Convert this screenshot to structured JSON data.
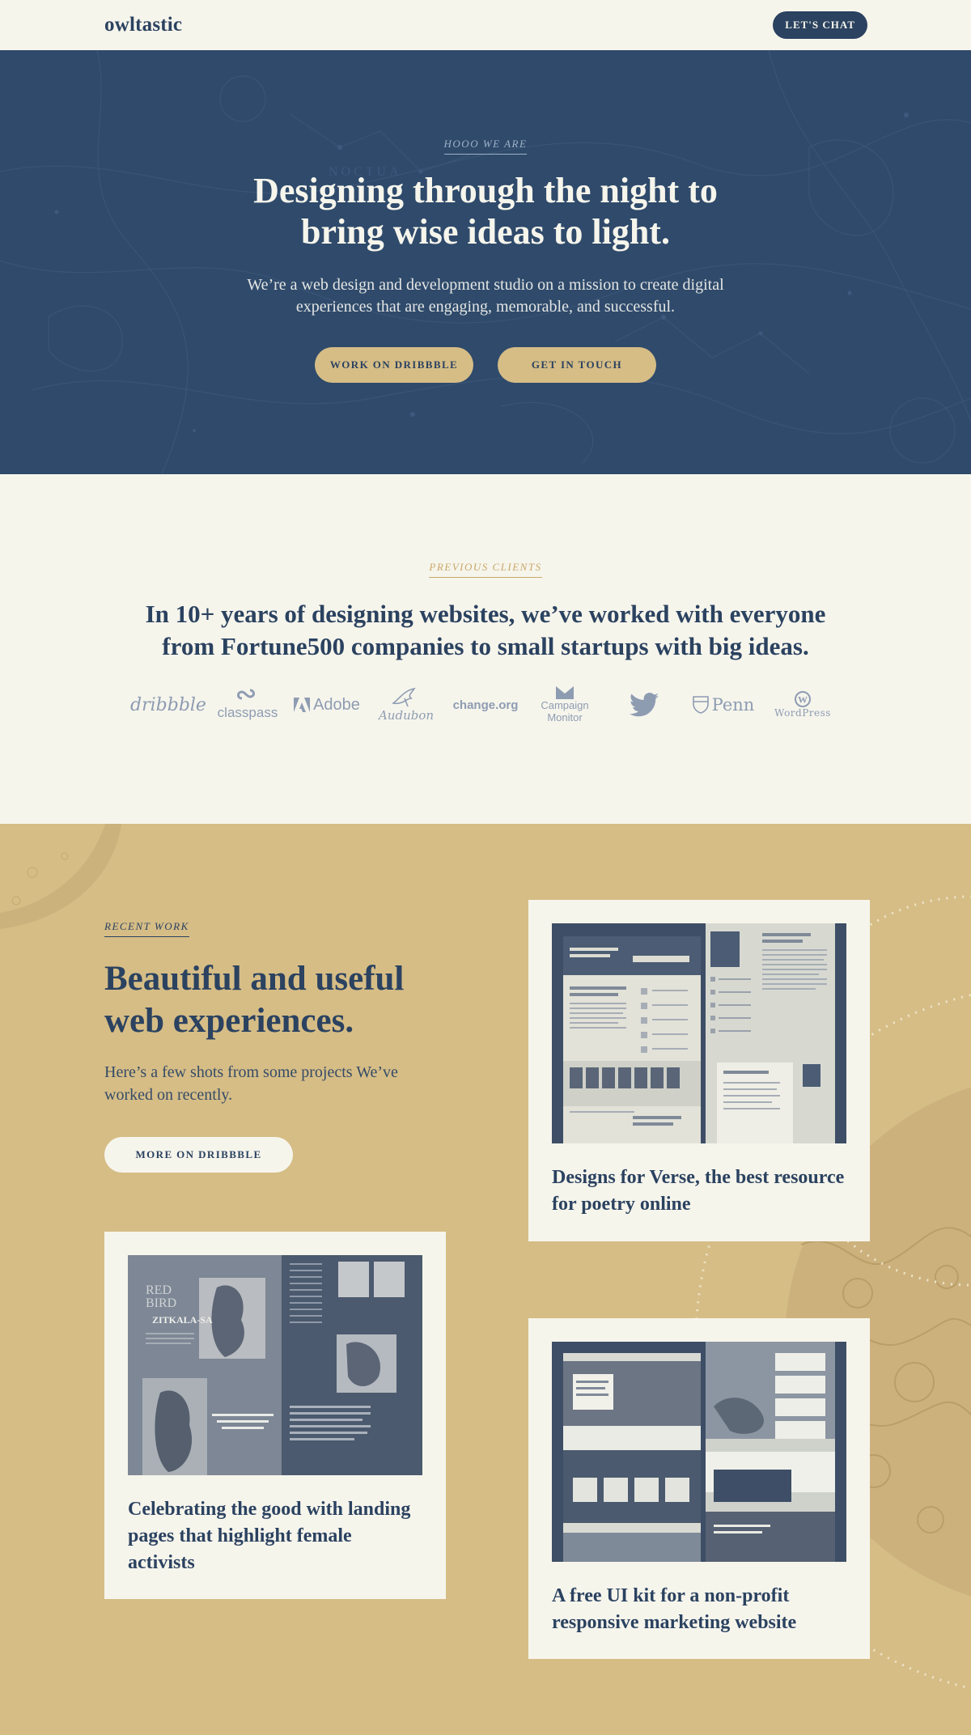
{
  "header": {
    "logo": "owltastic",
    "cta_label": "LET'S CHAT"
  },
  "hero": {
    "eyebrow": "HOOO WE ARE",
    "title_line1": "Designing through the night to",
    "title_line2": "bring wise ideas to light.",
    "description": "We’re a web design and development studio on a mission to create digital experiences that are engaging, memorable, and successful.",
    "buttons": [
      "WORK ON DRIBBBLE",
      "GET IN TOUCH"
    ],
    "map_labels": [
      "NOCTUA"
    ]
  },
  "clients": {
    "eyebrow": "PREVIOUS CLIENTS",
    "title_line1": "In 10+ years of designing websites, we’ve worked with everyone",
    "title_line2": "from Fortune500 companies to small startups with big ideas.",
    "logos": [
      {
        "name": "dribbble",
        "icon": "dribbble-logo"
      },
      {
        "name": "classpass",
        "icon": "classpass-logo"
      },
      {
        "name": "Adobe",
        "icon": "adobe-logo"
      },
      {
        "name": "Audubon",
        "icon": "audubon-logo"
      },
      {
        "name": "change.org",
        "icon": "change-org-logo"
      },
      {
        "name": "Campaign Monitor",
        "icon": "campaign-monitor-logo"
      },
      {
        "name": "",
        "icon": "twitter-logo"
      },
      {
        "name": "Penn",
        "icon": "penn-logo"
      },
      {
        "name": "WordPress",
        "icon": "wordpress-logo"
      }
    ]
  },
  "work": {
    "eyebrow": "RECENT WORK",
    "title_line1": "Beautiful and useful",
    "title_line2": "web experiences.",
    "description": "Here’s a few shots from some projects We’ve worked on recently.",
    "button_label": "MORE ON DRIBBBLE",
    "projects": [
      {
        "title": "Designs for Verse, the best resource for poetry online"
      },
      {
        "title": "Celebrating the good with landing pages that highlight female activists"
      },
      {
        "title": "A free UI kit for a non-profit responsive marketing website"
      }
    ]
  },
  "colors": {
    "navy": "#2b4260",
    "cream": "#f6f5ec",
    "gold": "#d6bd86",
    "hero_bg": "#2f4a6b"
  }
}
